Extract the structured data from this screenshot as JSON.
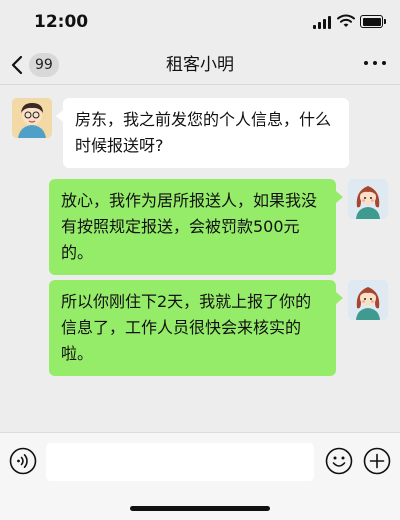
{
  "status_bar": {
    "time": "12:00"
  },
  "header": {
    "back_badge": "99",
    "title": "租客小明"
  },
  "messages": [
    {
      "side": "left",
      "text": "房东，我之前发您的个人信息，什么时候报送呀?"
    },
    {
      "side": "right",
      "text": "放心，我作为居所报送人，如果我没有按照规定报送，会被罚款500元的。"
    },
    {
      "side": "right",
      "text": "所以你刚住下2天，我就上报了你的信息了，工作人员很快会来核实的啦。"
    }
  ],
  "input_bar": {
    "placeholder": ""
  },
  "colors": {
    "background": "#ededed",
    "incoming_bubble": "#ffffff",
    "outgoing_bubble": "#95ec69",
    "badge": "#d8d8d8"
  },
  "icons": {
    "back": "chevron-left-icon",
    "more": "more-dots-icon",
    "voice": "voice-icon",
    "emoji": "emoji-icon",
    "add": "plus-icon"
  }
}
